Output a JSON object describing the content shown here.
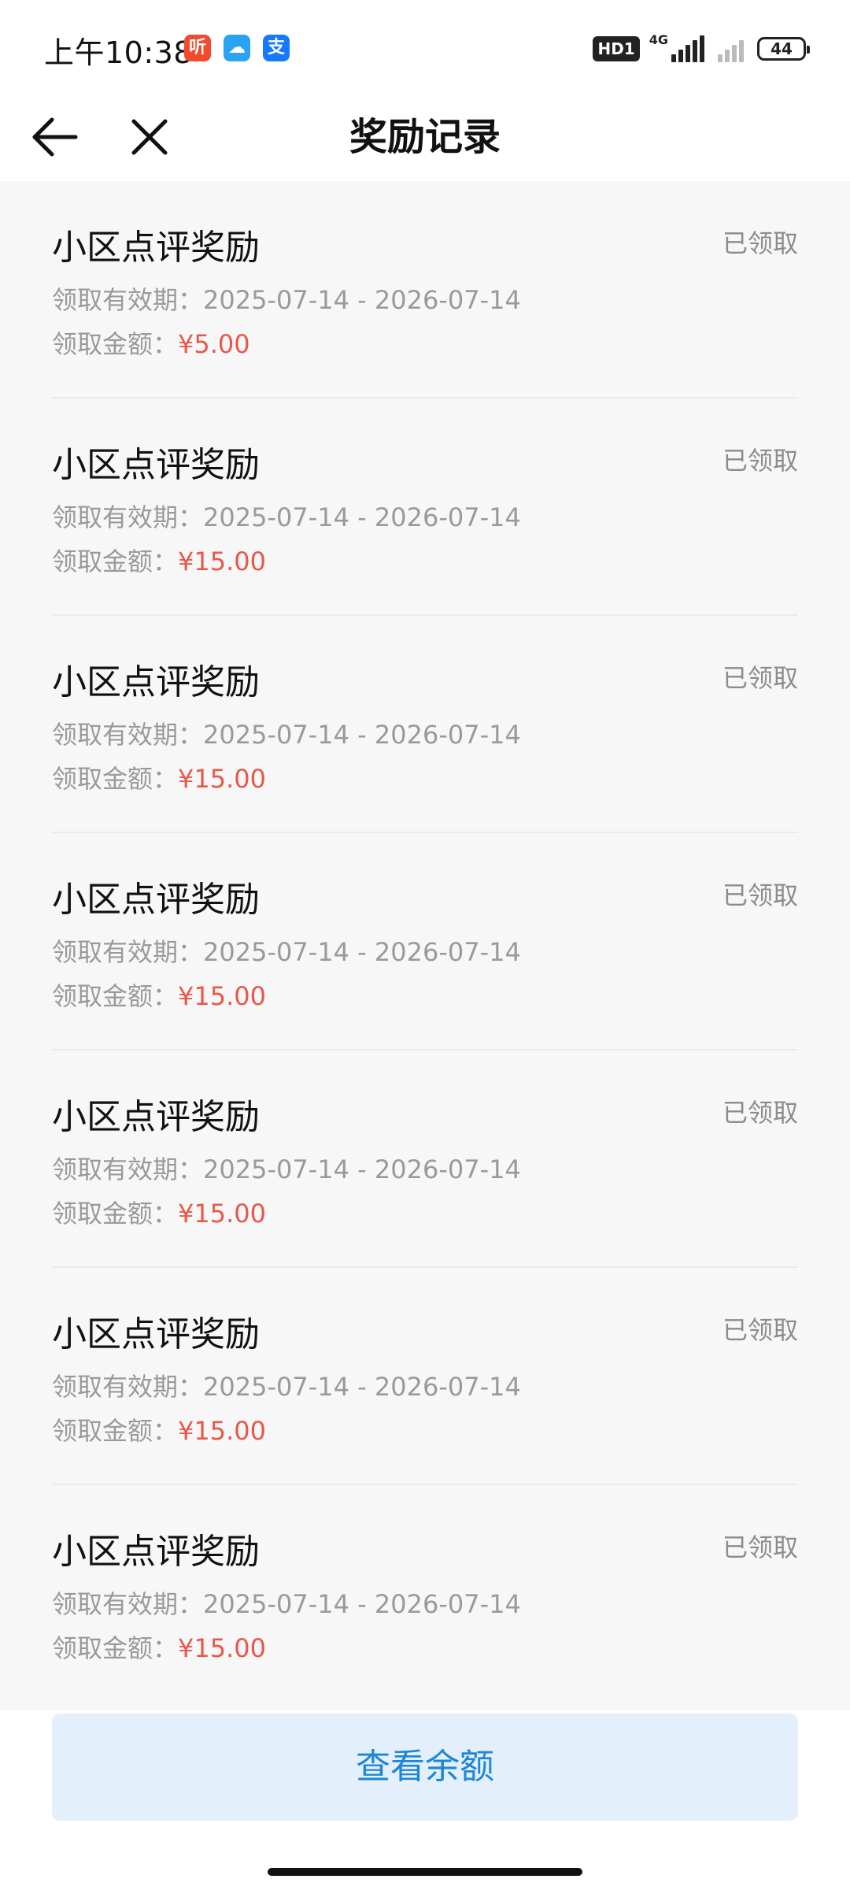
{
  "status_bar": {
    "time": "上午10:38",
    "badges": [
      {
        "icon": "listen-app-icon",
        "glyph": "听",
        "color": "#f24a2b"
      },
      {
        "icon": "cloud-app-icon",
        "glyph": "☁",
        "color": "#2aa3f0"
      },
      {
        "icon": "alipay-app-icon",
        "glyph": "支",
        "color": "#1677ff"
      }
    ],
    "hd_label": "HD1",
    "network_label": "4G",
    "battery_level": "44"
  },
  "nav": {
    "title": "奖励记录",
    "back_icon": "arrow-left-icon",
    "close_icon": "close-icon"
  },
  "labels": {
    "validity_prefix": "领取有效期：",
    "amount_prefix": "领取金额："
  },
  "records": [
    {
      "title": "小区点评奖励",
      "status": "已领取",
      "validity": "2025-07-14 - 2026-07-14",
      "amount": "¥5.00"
    },
    {
      "title": "小区点评奖励",
      "status": "已领取",
      "validity": "2025-07-14 - 2026-07-14",
      "amount": "¥15.00"
    },
    {
      "title": "小区点评奖励",
      "status": "已领取",
      "validity": "2025-07-14 - 2026-07-14",
      "amount": "¥15.00"
    },
    {
      "title": "小区点评奖励",
      "status": "已领取",
      "validity": "2025-07-14 - 2026-07-14",
      "amount": "¥15.00"
    },
    {
      "title": "小区点评奖励",
      "status": "已领取",
      "validity": "2025-07-14 - 2026-07-14",
      "amount": "¥15.00"
    },
    {
      "title": "小区点评奖励",
      "status": "已领取",
      "validity": "2025-07-14 - 2026-07-14",
      "amount": "¥15.00"
    },
    {
      "title": "小区点评奖励",
      "status": "已领取",
      "validity": "2025-07-14 - 2026-07-14",
      "amount": "¥15.00"
    }
  ],
  "footer": {
    "button_label": "查看余额"
  },
  "colors": {
    "amount": "#e8584a",
    "button_bg": "#e3effb",
    "button_text": "#1e86d6"
  }
}
